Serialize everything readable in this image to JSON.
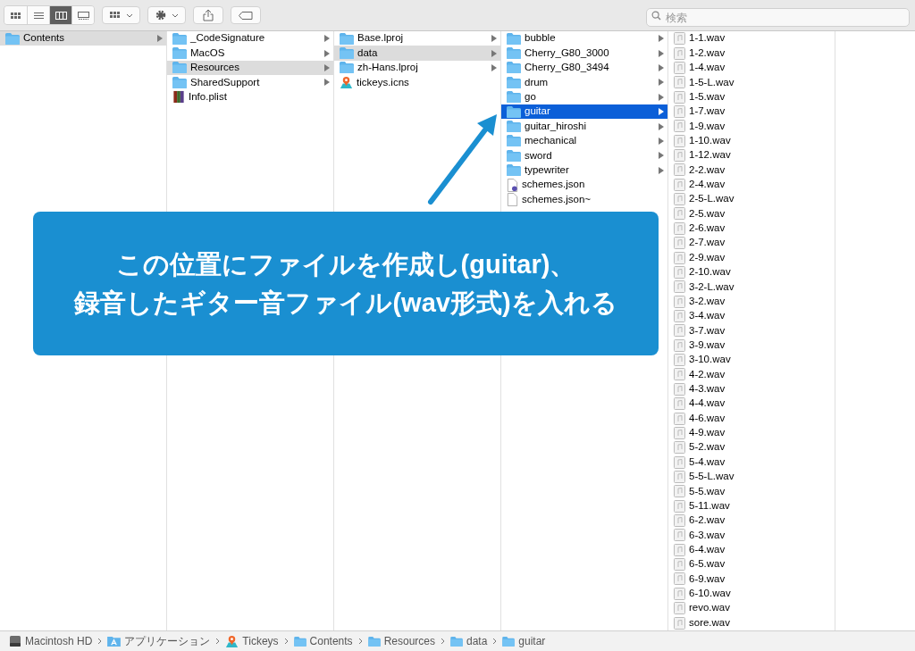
{
  "toolbar": {
    "view_modes": [
      {
        "selected": false
      },
      {
        "selected": false
      },
      {
        "selected": true
      },
      {
        "selected": false
      }
    ],
    "search": {
      "placeholder": "検索"
    }
  },
  "columns": [
    {
      "items": [
        {
          "name": "Contents",
          "kind": "folder",
          "expandable": true,
          "selected": true
        }
      ]
    },
    {
      "items": [
        {
          "name": "_CodeSignature",
          "kind": "folder",
          "expandable": true,
          "selected": false
        },
        {
          "name": "MacOS",
          "kind": "folder",
          "expandable": true,
          "selected": false
        },
        {
          "name": "Resources",
          "kind": "folder",
          "expandable": true,
          "selected": true
        },
        {
          "name": "SharedSupport",
          "kind": "folder",
          "expandable": true,
          "selected": false
        },
        {
          "name": "Info.plist",
          "kind": "plist",
          "expandable": false,
          "selected": false
        }
      ]
    },
    {
      "items": [
        {
          "name": "Base.lproj",
          "kind": "folder",
          "expandable": true,
          "selected": false
        },
        {
          "name": "data",
          "kind": "folder",
          "expandable": true,
          "selected": true
        },
        {
          "name": "zh-Hans.lproj",
          "kind": "folder",
          "expandable": true,
          "selected": false
        },
        {
          "name": "tickeys.icns",
          "kind": "app",
          "expandable": false,
          "selected": false
        }
      ]
    },
    {
      "items": [
        {
          "name": "bubble",
          "kind": "folder",
          "expandable": true,
          "selected": false
        },
        {
          "name": "Cherry_G80_3000",
          "kind": "folder",
          "expandable": true,
          "selected": false
        },
        {
          "name": "Cherry_G80_3494",
          "kind": "folder",
          "expandable": true,
          "selected": false
        },
        {
          "name": "drum",
          "kind": "folder",
          "expandable": true,
          "selected": false
        },
        {
          "name": "go",
          "kind": "folder",
          "expandable": true,
          "selected": false
        },
        {
          "name": "guitar",
          "kind": "folder",
          "expandable": true,
          "selected": true
        },
        {
          "name": "guitar_hiroshi",
          "kind": "folder",
          "expandable": true,
          "selected": false
        },
        {
          "name": "mechanical",
          "kind": "folder",
          "expandable": true,
          "selected": false
        },
        {
          "name": "sword",
          "kind": "folder",
          "expandable": true,
          "selected": false
        },
        {
          "name": "typewriter",
          "kind": "folder",
          "expandable": true,
          "selected": false
        },
        {
          "name": "schemes.json",
          "kind": "script",
          "expandable": false,
          "selected": false
        },
        {
          "name": "schemes.json~",
          "kind": "document",
          "expandable": false,
          "selected": false
        }
      ]
    },
    {
      "items": [
        {
          "name": "1-1.wav",
          "kind": "audio",
          "expandable": false,
          "selected": false
        },
        {
          "name": "1-2.wav",
          "kind": "audio",
          "expandable": false,
          "selected": false
        },
        {
          "name": "1-4.wav",
          "kind": "audio",
          "expandable": false,
          "selected": false
        },
        {
          "name": "1-5-L.wav",
          "kind": "audio",
          "expandable": false,
          "selected": false
        },
        {
          "name": "1-5.wav",
          "kind": "audio",
          "expandable": false,
          "selected": false
        },
        {
          "name": "1-7.wav",
          "kind": "audio",
          "expandable": false,
          "selected": false
        },
        {
          "name": "1-9.wav",
          "kind": "audio",
          "expandable": false,
          "selected": false
        },
        {
          "name": "1-10.wav",
          "kind": "audio",
          "expandable": false,
          "selected": false
        },
        {
          "name": "1-12.wav",
          "kind": "audio",
          "expandable": false,
          "selected": false
        },
        {
          "name": "2-2.wav",
          "kind": "audio",
          "expandable": false,
          "selected": false
        },
        {
          "name": "2-4.wav",
          "kind": "audio",
          "expandable": false,
          "selected": false
        },
        {
          "name": "2-5-L.wav",
          "kind": "audio",
          "expandable": false,
          "selected": false
        },
        {
          "name": "2-5.wav",
          "kind": "audio",
          "expandable": false,
          "selected": false
        },
        {
          "name": "2-6.wav",
          "kind": "audio",
          "expandable": false,
          "selected": false
        },
        {
          "name": "2-7.wav",
          "kind": "audio",
          "expandable": false,
          "selected": false
        },
        {
          "name": "2-9.wav",
          "kind": "audio",
          "expandable": false,
          "selected": false
        },
        {
          "name": "2-10.wav",
          "kind": "audio",
          "expandable": false,
          "selected": false
        },
        {
          "name": "3-2-L.wav",
          "kind": "audio",
          "expandable": false,
          "selected": false
        },
        {
          "name": "3-2.wav",
          "kind": "audio",
          "expandable": false,
          "selected": false
        },
        {
          "name": "3-4.wav",
          "kind": "audio",
          "expandable": false,
          "selected": false
        },
        {
          "name": "3-7.wav",
          "kind": "audio",
          "expandable": false,
          "selected": false
        },
        {
          "name": "3-9.wav",
          "kind": "audio",
          "expandable": false,
          "selected": false
        },
        {
          "name": "3-10.wav",
          "kind": "audio",
          "expandable": false,
          "selected": false
        },
        {
          "name": "4-2.wav",
          "kind": "audio",
          "expandable": false,
          "selected": false
        },
        {
          "name": "4-3.wav",
          "kind": "audio",
          "expandable": false,
          "selected": false
        },
        {
          "name": "4-4.wav",
          "kind": "audio",
          "expandable": false,
          "selected": false
        },
        {
          "name": "4-6.wav",
          "kind": "audio",
          "expandable": false,
          "selected": false
        },
        {
          "name": "4-9.wav",
          "kind": "audio",
          "expandable": false,
          "selected": false
        },
        {
          "name": "5-2.wav",
          "kind": "audio",
          "expandable": false,
          "selected": false
        },
        {
          "name": "5-4.wav",
          "kind": "audio",
          "expandable": false,
          "selected": false
        },
        {
          "name": "5-5-L.wav",
          "kind": "audio",
          "expandable": false,
          "selected": false
        },
        {
          "name": "5-5.wav",
          "kind": "audio",
          "expandable": false,
          "selected": false
        },
        {
          "name": "5-11.wav",
          "kind": "audio",
          "expandable": false,
          "selected": false
        },
        {
          "name": "6-2.wav",
          "kind": "audio",
          "expandable": false,
          "selected": false
        },
        {
          "name": "6-3.wav",
          "kind": "audio",
          "expandable": false,
          "selected": false
        },
        {
          "name": "6-4.wav",
          "kind": "audio",
          "expandable": false,
          "selected": false
        },
        {
          "name": "6-5.wav",
          "kind": "audio",
          "expandable": false,
          "selected": false
        },
        {
          "name": "6-9.wav",
          "kind": "audio",
          "expandable": false,
          "selected": false
        },
        {
          "name": "6-10.wav",
          "kind": "audio",
          "expandable": false,
          "selected": false
        },
        {
          "name": "revo.wav",
          "kind": "audio",
          "expandable": false,
          "selected": false
        },
        {
          "name": "sore.wav",
          "kind": "audio",
          "expandable": false,
          "selected": false
        }
      ]
    }
  ],
  "callout": {
    "lines": [
      "この位置にファイルを作成し(guitar)、",
      "録音したギター音ファイル(wav形式)を入れる"
    ]
  },
  "path_bar": [
    {
      "name": "Macintosh HD",
      "kind": "disk"
    },
    {
      "name": "アプリケーション",
      "kind": "apps"
    },
    {
      "name": "Tickeys",
      "kind": "app"
    },
    {
      "name": "Contents",
      "kind": "folder"
    },
    {
      "name": "Resources",
      "kind": "folder"
    },
    {
      "name": "data",
      "kind": "folder"
    },
    {
      "name": "guitar",
      "kind": "folder"
    }
  ]
}
